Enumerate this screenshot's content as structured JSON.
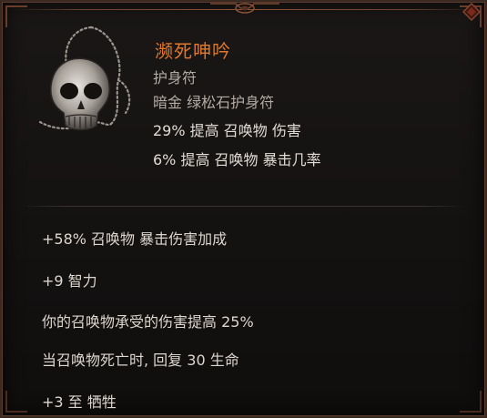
{
  "item": {
    "name": "濒死呻吟",
    "type": "护身符",
    "rarity": "暗金 绿松石护身符",
    "implicits": [
      "29% 提高 召唤物 伤害",
      "6% 提高 召唤物 暴击几率"
    ],
    "affixes": [
      "+58% 召唤物 暴击伤害加成",
      "+9 智力",
      "你的召唤物承受的伤害提高 25%",
      "当召唤物死亡时, 回复 30 生命",
      "+3 至 牺牲"
    ],
    "icon": "skull-amulet-icon"
  },
  "colors": {
    "name": "#e0792c",
    "subtitle": "#b3aba2",
    "stat": "#e2dcd5",
    "border": "#5a3a2c",
    "background": "#151312"
  }
}
